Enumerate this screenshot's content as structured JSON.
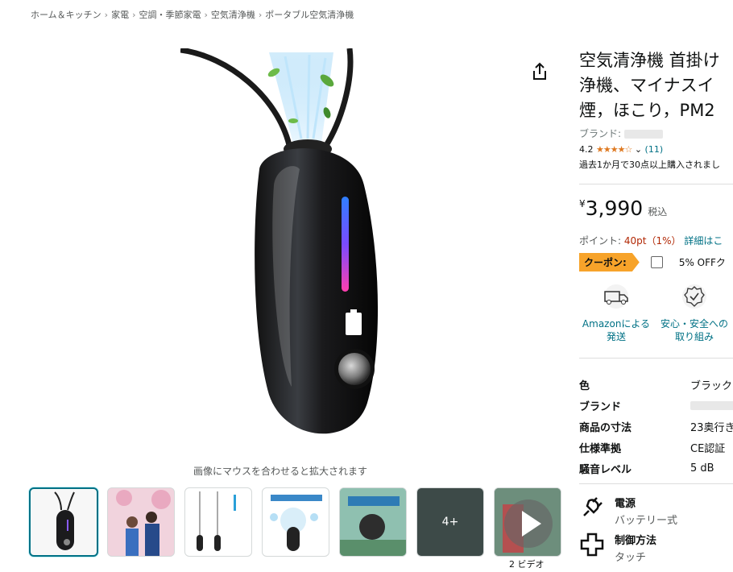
{
  "breadcrumb": [
    "ホーム＆キッチン",
    "家電",
    "空調・季節家電",
    "空気清浄機",
    "ポータブル空気清浄機"
  ],
  "breadcrumb_sep": "›",
  "image_hint": "画像にマウスを合わせると拡大されます",
  "thumbs_more": "4+",
  "video_caption": "2 ビデオ",
  "product": {
    "title_lines": [
      "空気清浄機 首掛け",
      "浄機、マイナスイ",
      "煙，ほこり，PM2"
    ],
    "brand_label": "ブランド:",
    "rating_value": "4.2",
    "rating_stars": "★★★★☆",
    "rating_count": "(11)",
    "bought": "過去1か月で30点以上購入されまし",
    "price_symbol": "¥",
    "price": "3,990",
    "price_tax": "税込",
    "points_label": "ポイント:",
    "points_value": "40pt（1%）",
    "points_detail": "詳細はこ",
    "coupon_label": "クーポン:",
    "coupon_text": "5% OFFク"
  },
  "features": [
    {
      "icon": "delivery-van-icon",
      "line1": "Amazonによる",
      "line2": "発送"
    },
    {
      "icon": "safety-badge-icon",
      "line1": "安心・安全への",
      "line2": "取り組み"
    }
  ],
  "specs": [
    {
      "key": "色",
      "value": "ブラック"
    },
    {
      "key": "ブランド",
      "value": ""
    },
    {
      "key": "商品の寸法",
      "value": "23奥行き"
    },
    {
      "key": "仕様準拠",
      "value": "CE認証"
    },
    {
      "key": "騒音レベル",
      "value": "5 dB"
    }
  ],
  "details": [
    {
      "icon": "plug-icon",
      "title": "電源",
      "value": "バッテリー式"
    },
    {
      "icon": "control-plus-icon",
      "title": "制御方法",
      "value": "タッチ"
    }
  ],
  "colors": {
    "link": "#007185",
    "coupon": "#f7a32a",
    "stars": "#de7921",
    "active_thumb": "#007185"
  }
}
